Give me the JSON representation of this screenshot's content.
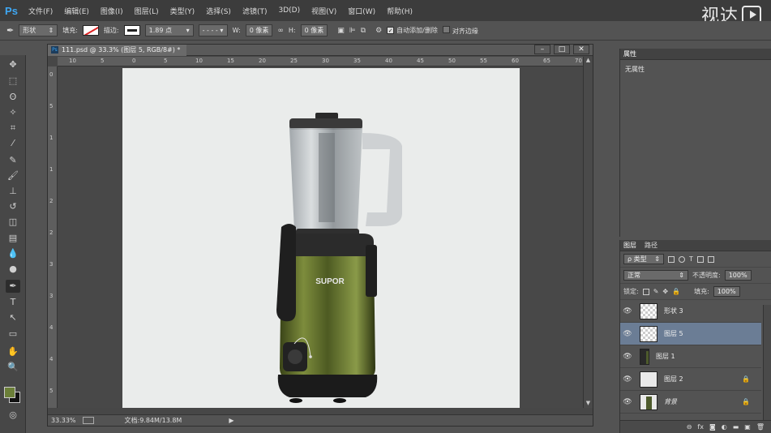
{
  "app": {
    "logo": "Ps"
  },
  "menu": [
    "文件(F)",
    "编辑(E)",
    "图像(I)",
    "图层(L)",
    "类型(Y)",
    "选择(S)",
    "滤镜(T)",
    "3D(D)",
    "视图(V)",
    "窗口(W)",
    "帮助(H)"
  ],
  "watermark": "视达",
  "options": {
    "shape_mode": "形状",
    "fill_label": "填充:",
    "stroke_label": "描边:",
    "stroke_width": "1.89 点",
    "w_label": "W:",
    "w_value": "0 像素",
    "h_label": "H:",
    "h_value": "0 像素",
    "auto_add_label": "自动添加/删除",
    "align_edges_label": "对齐边缘"
  },
  "document": {
    "tab_title": "111.psd @ 33.3% (图层 5, RGB/8#) *",
    "ruler_top": [
      "10",
      "5",
      "0",
      "5",
      "10",
      "15",
      "20",
      "25",
      "30",
      "35",
      "40",
      "45",
      "50",
      "55",
      "60",
      "65",
      "70"
    ],
    "ruler_left": [
      "0",
      "5",
      "1",
      "1",
      "2",
      "2",
      "3",
      "3",
      "4",
      "4",
      "5"
    ],
    "product_brand": "SUPOR",
    "zoom": "33.33%",
    "doc_info": "文档:9.84M/13.8M"
  },
  "properties": {
    "tab": "属性",
    "content": "无属性"
  },
  "layers": {
    "tabs": [
      "图层",
      "路径"
    ],
    "filter_kind": "ρ 类型",
    "blend_mode": "正常",
    "opacity_label": "不透明度:",
    "opacity_value": "100%",
    "lock_label": "锁定:",
    "fill_label": "填充:",
    "fill_value": "100%",
    "items": [
      {
        "name": "形状 3",
        "selected": false,
        "locked": false
      },
      {
        "name": "图层 5",
        "selected": true,
        "locked": false
      },
      {
        "name": "图层 1",
        "selected": false,
        "locked": false
      },
      {
        "name": "图层 2",
        "selected": false,
        "locked": true
      },
      {
        "name": "背景",
        "selected": false,
        "locked": true
      }
    ]
  },
  "colors": {
    "foreground": "#6b7f38",
    "background": "#111111",
    "selection": "#6b7d95"
  }
}
